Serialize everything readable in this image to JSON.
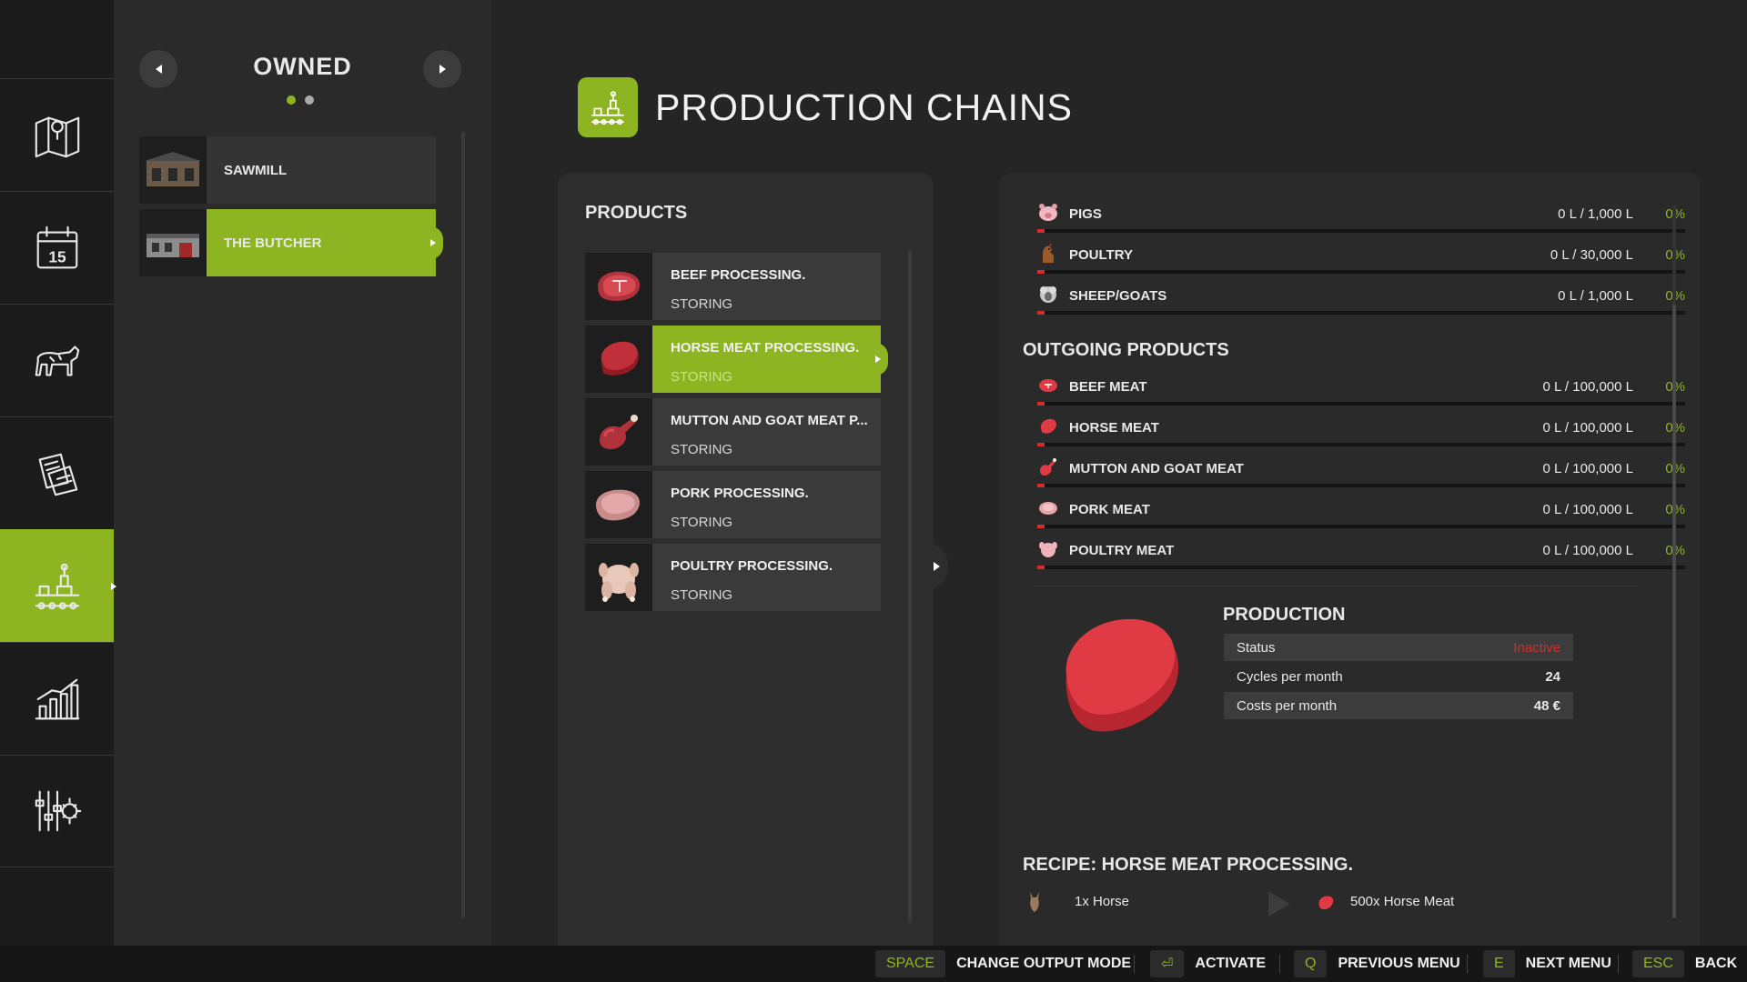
{
  "owned": {
    "title": "OWNED",
    "pages": 2,
    "current_page": 1,
    "items": [
      {
        "label": "SAWMILL",
        "selected": false
      },
      {
        "label": "THE BUTCHER",
        "selected": true
      }
    ]
  },
  "header": {
    "title": "PRODUCTION CHAINS"
  },
  "products": {
    "title": "PRODUCTS",
    "items": [
      {
        "name": "BEEF PROCESSING.",
        "status": "STORING",
        "selected": false
      },
      {
        "name": "HORSE MEAT PROCESSING.",
        "status": "STORING",
        "selected": true
      },
      {
        "name": "MUTTON AND GOAT MEAT P...",
        "status": "STORING",
        "selected": false
      },
      {
        "name": "PORK PROCESSING.",
        "status": "STORING",
        "selected": false
      },
      {
        "name": "POULTRY PROCESSING.",
        "status": "STORING",
        "selected": false
      }
    ]
  },
  "incoming": [
    {
      "name": "PIGS",
      "value": "0 L / 1,000 L",
      "percent": "0%",
      "fill": 0
    },
    {
      "name": "POULTRY",
      "value": "0 L / 30,000 L",
      "percent": "0%",
      "fill": 0
    },
    {
      "name": "SHEEP/GOATS",
      "value": "0 L / 1,000 L",
      "percent": "0%",
      "fill": 0
    }
  ],
  "outgoing": {
    "title": "OUTGOING PRODUCTS",
    "items": [
      {
        "name": "BEEF MEAT",
        "value": "0 L / 100,000 L",
        "percent": "0%",
        "fill": 0
      },
      {
        "name": "HORSE MEAT",
        "value": "0 L / 100,000 L",
        "percent": "0%",
        "fill": 0
      },
      {
        "name": "MUTTON AND GOAT MEAT",
        "value": "0 L / 100,000 L",
        "percent": "0%",
        "fill": 0
      },
      {
        "name": "PORK MEAT",
        "value": "0 L / 100,000 L",
        "percent": "0%",
        "fill": 0
      },
      {
        "name": "POULTRY MEAT",
        "value": "0 L / 100,000 L",
        "percent": "0%",
        "fill": 0
      }
    ]
  },
  "production": {
    "title": "PRODUCTION",
    "status_label": "Status",
    "status_value": "Inactive",
    "cycles_label": "Cycles per month",
    "cycles_value": "24",
    "costs_label": "Costs per month",
    "costs_value": "48 €"
  },
  "recipe": {
    "title": "RECIPE: HORSE MEAT PROCESSING.",
    "input": "1x Horse",
    "output": "500x Horse Meat"
  },
  "footer": {
    "hints": [
      {
        "key": "SPACE",
        "action": "CHANGE OUTPUT MODE"
      },
      {
        "key": "⏎",
        "action": "ACTIVATE"
      },
      {
        "key": "Q",
        "action": "PREVIOUS MENU"
      },
      {
        "key": "E",
        "action": "NEXT MENU"
      },
      {
        "key": "ESC",
        "action": "BACK"
      }
    ]
  },
  "colors": {
    "accent": "#8db521",
    "danger": "#d92b2b",
    "meat": "#e03b45",
    "background": "#252525",
    "panel": "#2d2d2d"
  },
  "rail": {
    "items": [
      "map-icon",
      "calendar-icon",
      "animals-icon",
      "contracts-icon",
      "production-icon",
      "statistics-icon",
      "settings-icon"
    ],
    "active_index": 4,
    "calendar_day": "15"
  }
}
